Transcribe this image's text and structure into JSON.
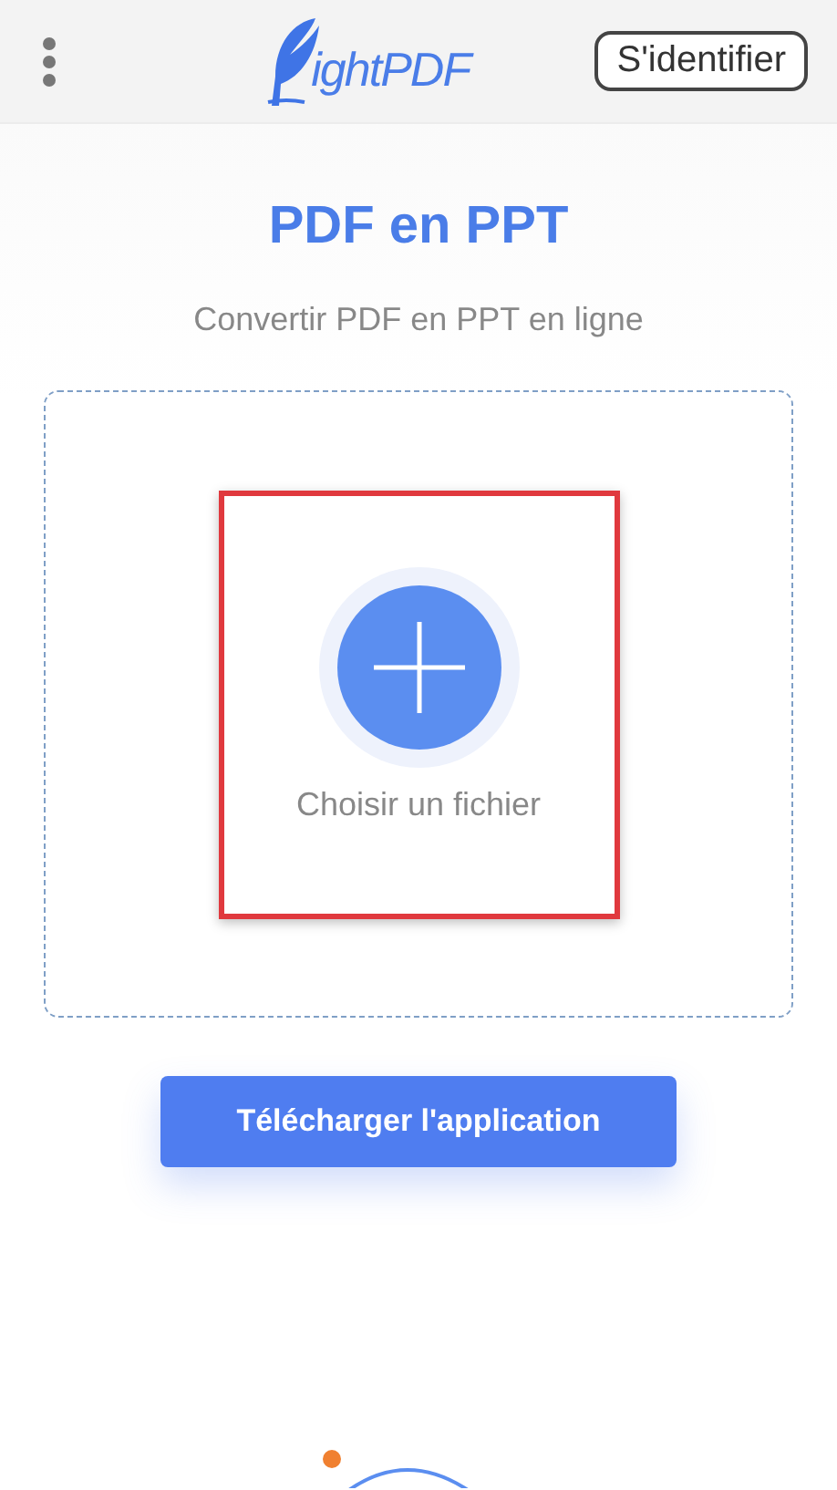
{
  "header": {
    "logo_text": "ightPDF",
    "login_button": "S'identifier"
  },
  "title": "PDF en PPT",
  "subtitle": "Convertir PDF en PPT en ligne",
  "upload": {
    "label": "Choisir un fichier",
    "highlighted": true
  },
  "download_button": "Télécharger l'application"
}
